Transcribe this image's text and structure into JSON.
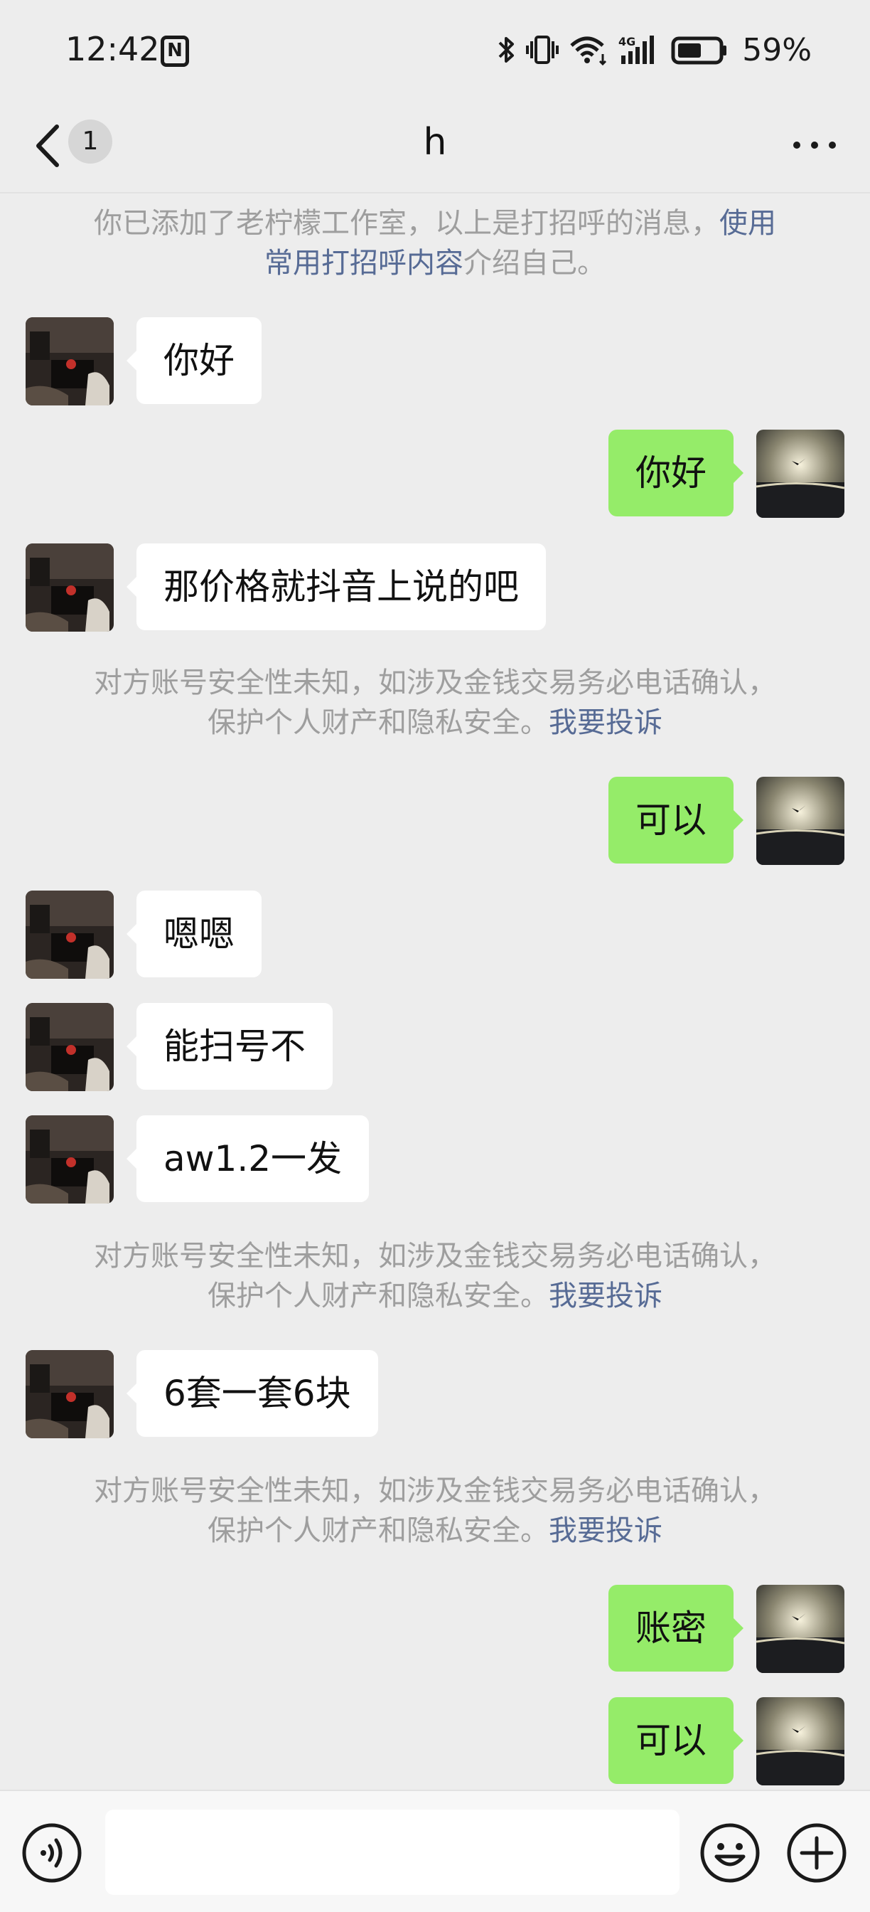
{
  "status_bar": {
    "time": "12:42",
    "nfc_glyph": "N",
    "battery_percent": "59%",
    "battery_level": 0.59,
    "icons": [
      "bluetooth-icon",
      "vibrate-icon",
      "wifi-icon",
      "signal-4g-icon",
      "battery-icon"
    ]
  },
  "header": {
    "back_icon": "chevron-left-icon",
    "unread_count": "1",
    "title": "h",
    "more_icon": "more-dots-icon"
  },
  "notices": {
    "added": {
      "prefix": "你已添加了老柠檬工作室，以上是打招呼的消息，",
      "link1": "使用",
      "link2": "常用打招呼内容",
      "suffix": "介绍自己。"
    },
    "security": {
      "line1": "对方账号安全性未知，如涉及金钱交易务必电话确认，",
      "line2": "保护个人财产和隐私安全。",
      "link": "我要投诉"
    }
  },
  "messages": [
    {
      "side": "in",
      "text": "你好"
    },
    {
      "side": "out",
      "text": "你好"
    },
    {
      "side": "in",
      "text": "那价格就抖音上说的吧"
    },
    {
      "side": "out",
      "text": "可以"
    },
    {
      "side": "in",
      "text": "嗯嗯"
    },
    {
      "side": "in",
      "text": "能扫号不"
    },
    {
      "side": "in",
      "text": "aw1.2一发"
    },
    {
      "side": "in",
      "text": "6套一套6块"
    },
    {
      "side": "out",
      "text": "账密"
    },
    {
      "side": "out",
      "text": "可以"
    }
  ],
  "input_bar": {
    "voice_icon": "voice-icon",
    "input_value": "",
    "emoji_icon": "emoji-icon",
    "plus_icon": "plus-icon"
  },
  "colors": {
    "background": "#ededed",
    "incoming_bubble": "#ffffff",
    "outgoing_bubble": "#95ec69",
    "link": "#576b95",
    "notice_text": "#9e9e9e"
  }
}
